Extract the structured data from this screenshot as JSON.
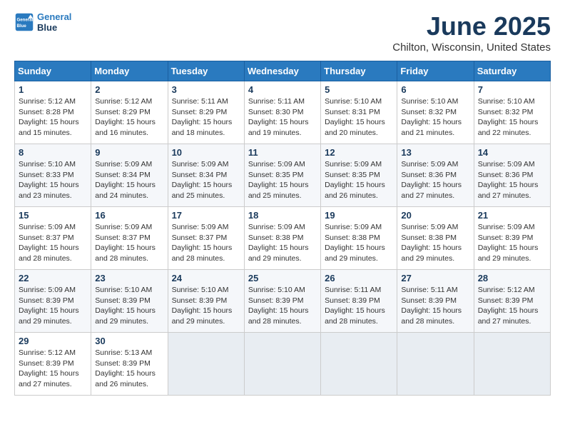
{
  "header": {
    "logo_line1": "General",
    "logo_line2": "Blue",
    "month": "June 2025",
    "location": "Chilton, Wisconsin, United States"
  },
  "weekdays": [
    "Sunday",
    "Monday",
    "Tuesday",
    "Wednesday",
    "Thursday",
    "Friday",
    "Saturday"
  ],
  "weeks": [
    [
      {
        "day": "1",
        "info": "Sunrise: 5:12 AM\nSunset: 8:28 PM\nDaylight: 15 hours\nand 15 minutes."
      },
      {
        "day": "2",
        "info": "Sunrise: 5:12 AM\nSunset: 8:29 PM\nDaylight: 15 hours\nand 16 minutes."
      },
      {
        "day": "3",
        "info": "Sunrise: 5:11 AM\nSunset: 8:29 PM\nDaylight: 15 hours\nand 18 minutes."
      },
      {
        "day": "4",
        "info": "Sunrise: 5:11 AM\nSunset: 8:30 PM\nDaylight: 15 hours\nand 19 minutes."
      },
      {
        "day": "5",
        "info": "Sunrise: 5:10 AM\nSunset: 8:31 PM\nDaylight: 15 hours\nand 20 minutes."
      },
      {
        "day": "6",
        "info": "Sunrise: 5:10 AM\nSunset: 8:32 PM\nDaylight: 15 hours\nand 21 minutes."
      },
      {
        "day": "7",
        "info": "Sunrise: 5:10 AM\nSunset: 8:32 PM\nDaylight: 15 hours\nand 22 minutes."
      }
    ],
    [
      {
        "day": "8",
        "info": "Sunrise: 5:10 AM\nSunset: 8:33 PM\nDaylight: 15 hours\nand 23 minutes."
      },
      {
        "day": "9",
        "info": "Sunrise: 5:09 AM\nSunset: 8:34 PM\nDaylight: 15 hours\nand 24 minutes."
      },
      {
        "day": "10",
        "info": "Sunrise: 5:09 AM\nSunset: 8:34 PM\nDaylight: 15 hours\nand 25 minutes."
      },
      {
        "day": "11",
        "info": "Sunrise: 5:09 AM\nSunset: 8:35 PM\nDaylight: 15 hours\nand 25 minutes."
      },
      {
        "day": "12",
        "info": "Sunrise: 5:09 AM\nSunset: 8:35 PM\nDaylight: 15 hours\nand 26 minutes."
      },
      {
        "day": "13",
        "info": "Sunrise: 5:09 AM\nSunset: 8:36 PM\nDaylight: 15 hours\nand 27 minutes."
      },
      {
        "day": "14",
        "info": "Sunrise: 5:09 AM\nSunset: 8:36 PM\nDaylight: 15 hours\nand 27 minutes."
      }
    ],
    [
      {
        "day": "15",
        "info": "Sunrise: 5:09 AM\nSunset: 8:37 PM\nDaylight: 15 hours\nand 28 minutes."
      },
      {
        "day": "16",
        "info": "Sunrise: 5:09 AM\nSunset: 8:37 PM\nDaylight: 15 hours\nand 28 minutes."
      },
      {
        "day": "17",
        "info": "Sunrise: 5:09 AM\nSunset: 8:37 PM\nDaylight: 15 hours\nand 28 minutes."
      },
      {
        "day": "18",
        "info": "Sunrise: 5:09 AM\nSunset: 8:38 PM\nDaylight: 15 hours\nand 29 minutes."
      },
      {
        "day": "19",
        "info": "Sunrise: 5:09 AM\nSunset: 8:38 PM\nDaylight: 15 hours\nand 29 minutes."
      },
      {
        "day": "20",
        "info": "Sunrise: 5:09 AM\nSunset: 8:38 PM\nDaylight: 15 hours\nand 29 minutes."
      },
      {
        "day": "21",
        "info": "Sunrise: 5:09 AM\nSunset: 8:39 PM\nDaylight: 15 hours\nand 29 minutes."
      }
    ],
    [
      {
        "day": "22",
        "info": "Sunrise: 5:09 AM\nSunset: 8:39 PM\nDaylight: 15 hours\nand 29 minutes."
      },
      {
        "day": "23",
        "info": "Sunrise: 5:10 AM\nSunset: 8:39 PM\nDaylight: 15 hours\nand 29 minutes."
      },
      {
        "day": "24",
        "info": "Sunrise: 5:10 AM\nSunset: 8:39 PM\nDaylight: 15 hours\nand 29 minutes."
      },
      {
        "day": "25",
        "info": "Sunrise: 5:10 AM\nSunset: 8:39 PM\nDaylight: 15 hours\nand 28 minutes."
      },
      {
        "day": "26",
        "info": "Sunrise: 5:11 AM\nSunset: 8:39 PM\nDaylight: 15 hours\nand 28 minutes."
      },
      {
        "day": "27",
        "info": "Sunrise: 5:11 AM\nSunset: 8:39 PM\nDaylight: 15 hours\nand 28 minutes."
      },
      {
        "day": "28",
        "info": "Sunrise: 5:12 AM\nSunset: 8:39 PM\nDaylight: 15 hours\nand 27 minutes."
      }
    ],
    [
      {
        "day": "29",
        "info": "Sunrise: 5:12 AM\nSunset: 8:39 PM\nDaylight: 15 hours\nand 27 minutes."
      },
      {
        "day": "30",
        "info": "Sunrise: 5:13 AM\nSunset: 8:39 PM\nDaylight: 15 hours\nand 26 minutes."
      },
      {
        "day": "",
        "info": ""
      },
      {
        "day": "",
        "info": ""
      },
      {
        "day": "",
        "info": ""
      },
      {
        "day": "",
        "info": ""
      },
      {
        "day": "",
        "info": ""
      }
    ]
  ]
}
